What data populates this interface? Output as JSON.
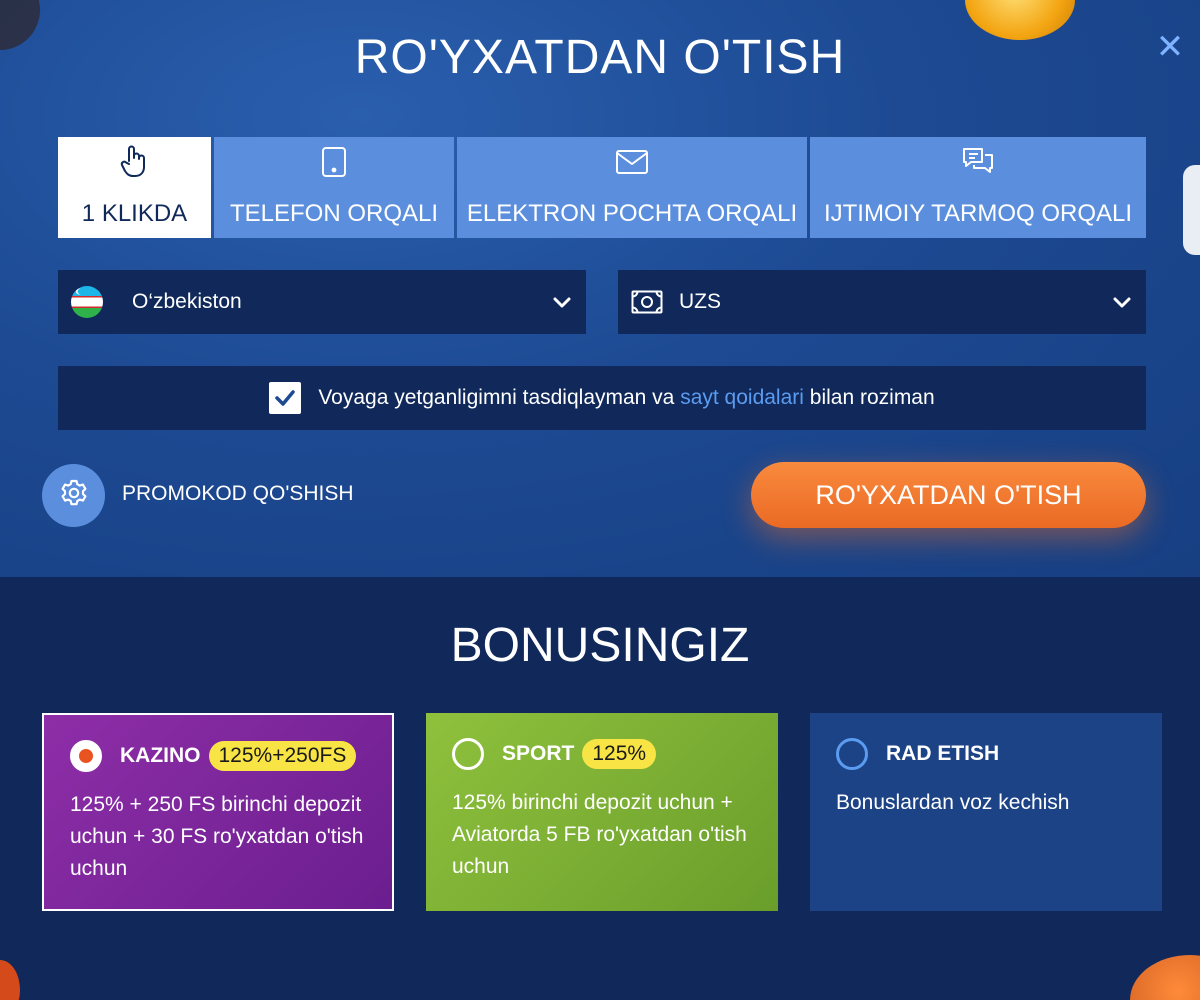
{
  "header": {
    "title": "RO'YXATDAN O'TISH",
    "close_glyph": "✕"
  },
  "tabs": [
    {
      "label": "1 KLIKDA",
      "icon": "hand-pointer-icon",
      "active": true
    },
    {
      "label": "TELEFON ORQALI",
      "icon": "tablet-icon",
      "active": false
    },
    {
      "label": "ELEKTRON POCHTA ORQALI",
      "icon": "envelope-icon",
      "active": false
    },
    {
      "label": "IJTIMOIY TARMOQ ORQALI",
      "icon": "chat-bubbles-icon",
      "active": false
    }
  ],
  "country": {
    "value": "O‘zbekiston",
    "icon": "uzbekistan-flag-icon"
  },
  "currency": {
    "value": "UZS",
    "icon": "money-bill-icon"
  },
  "agreement": {
    "checked": true,
    "text_before": "Voyaga yetganligimni tasdiqlayman va ",
    "link_text": "sayt qoidalari",
    "text_after": " bilan roziman"
  },
  "promo": {
    "label": "PROMOKOD QO'SHISH",
    "icon": "gear-icon"
  },
  "submit": {
    "label": "RO'YXATDAN O'TISH"
  },
  "bonus": {
    "title": "BONUSINGIZ",
    "options": [
      {
        "name": "KAZINO",
        "badge": "125%+250FS",
        "desc": "125% + 250 FS birinchi depozit uchun + 30 FS ro'yxatdan o'tish uchun",
        "selected": true
      },
      {
        "name": "SPORT",
        "badge": "125%",
        "desc": "125% birinchi depozit uchun + Aviatorda 5 FB ro'yxatdan o'tish uchun",
        "selected": false
      },
      {
        "name": "RAD ETISH",
        "badge": "",
        "desc": "Bonuslardan voz kechish",
        "selected": false
      }
    ]
  },
  "colors": {
    "background_dark": "#10295a",
    "tab_blue": "#5b8fde",
    "link_blue": "#5b9bf0",
    "submit_orange": "#ea6a24",
    "badge_yellow": "#f8e444",
    "kazino_purple": "#8e2ea8",
    "sport_green": "#8fc13d"
  }
}
